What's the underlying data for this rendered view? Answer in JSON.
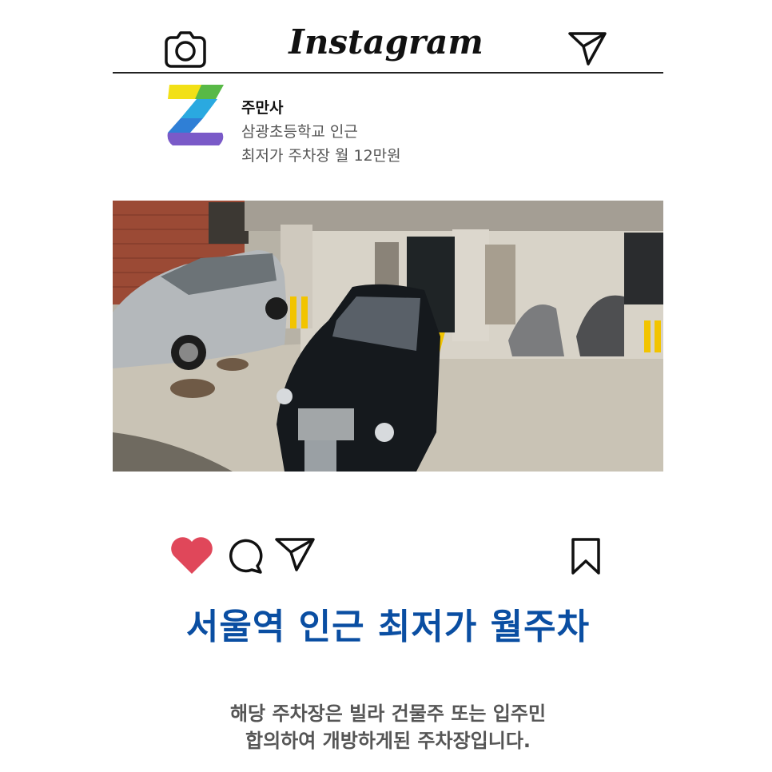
{
  "header": {
    "title": "Instagram",
    "camera_icon": "camera-icon",
    "send_icon": "paper-plane-icon"
  },
  "profile": {
    "avatar_icon": "z-logo-icon",
    "name": "주만사",
    "line1": "삼광초등학교 인근",
    "line2": "최저가 주차장 월 12만원"
  },
  "photo": {
    "description_icon": "parking-lot-photo"
  },
  "actions": {
    "heart_icon": "heart-icon",
    "comment_icon": "comment-icon",
    "share_icon": "paper-plane-icon",
    "bookmark_icon": "bookmark-icon",
    "heart_color": "#e0475a"
  },
  "post": {
    "headline": "서울역 인근 최저가 월주차",
    "caption_line1": "해당 주차장은 빌라 건물주 또는 입주민",
    "caption_line2": "합의하여 개방하게된 주차장입니다.",
    "headline_color": "#0a4ea2"
  }
}
